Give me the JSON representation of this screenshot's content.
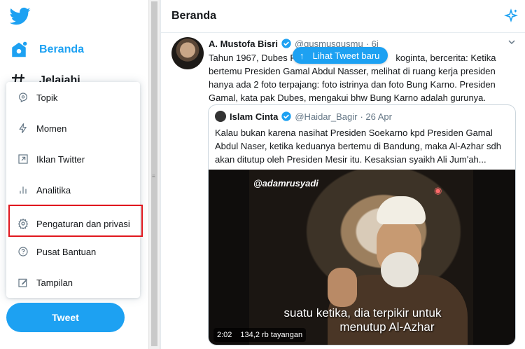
{
  "sidebar": {
    "home_label": "Beranda",
    "explore_label": "Jelajahi"
  },
  "menu": {
    "items": [
      {
        "label": "Topik",
        "icon": "topic-icon"
      },
      {
        "label": "Momen",
        "icon": "lightning-icon"
      },
      {
        "label": "Iklan Twitter",
        "icon": "external-link-icon"
      },
      {
        "label": "Analitika",
        "icon": "bar-chart-icon"
      },
      {
        "label": "Pengaturan dan privasi",
        "icon": "gear-icon"
      },
      {
        "label": "Pusat Bantuan",
        "icon": "help-icon"
      },
      {
        "label": "Tampilan",
        "icon": "edit-icon"
      }
    ],
    "highlighted_index": 4,
    "highlight_color": "#e0171e"
  },
  "tweet_button_label": "Tweet",
  "header": {
    "title": "Beranda"
  },
  "new_tweets_label": "Lihat Tweet baru",
  "tweet": {
    "name": "A. Mustofa Bisri",
    "handle": "@gusmusgusmu",
    "time": "· 6j",
    "text_line1_start": "Tahun 1967, Dubes RI",
    "text_line1_end": "koginta, bercerita: Ketika",
    "text_rest": "bertemu Presiden Gamal Abdul Nasser, melihat di ruang kerja presiden hanya ada 2 foto terpajang: foto istrinya dan foto Bung Karno. Presiden Gamal, kata pak Dubes, mengakui bhw Bung Karno adalah gurunya."
  },
  "quote": {
    "name": "Islam Cinta",
    "handle": "@Haidar_Bagir",
    "time": "· 26 Apr",
    "text": "Kalau bukan karena nasihat Presiden Soekarno kpd Presiden Gamal Abdul Naser, ketika keduanya bertemu di Bandung, maka Al-Azhar sdh akan ditutup oleh Presiden Mesir itu. Kesaksian syaikh Ali Jum'ah..."
  },
  "video": {
    "watermark": "@adamrusyadi",
    "subtitle_line1": "suatu ketika, dia terpikir untuk",
    "subtitle_line2": "menutup Al-Azhar",
    "duration": "2:02",
    "views": "134,2 rb tayangan"
  },
  "colors": {
    "accent": "#1da1f2",
    "border": "#e6ecf0"
  }
}
